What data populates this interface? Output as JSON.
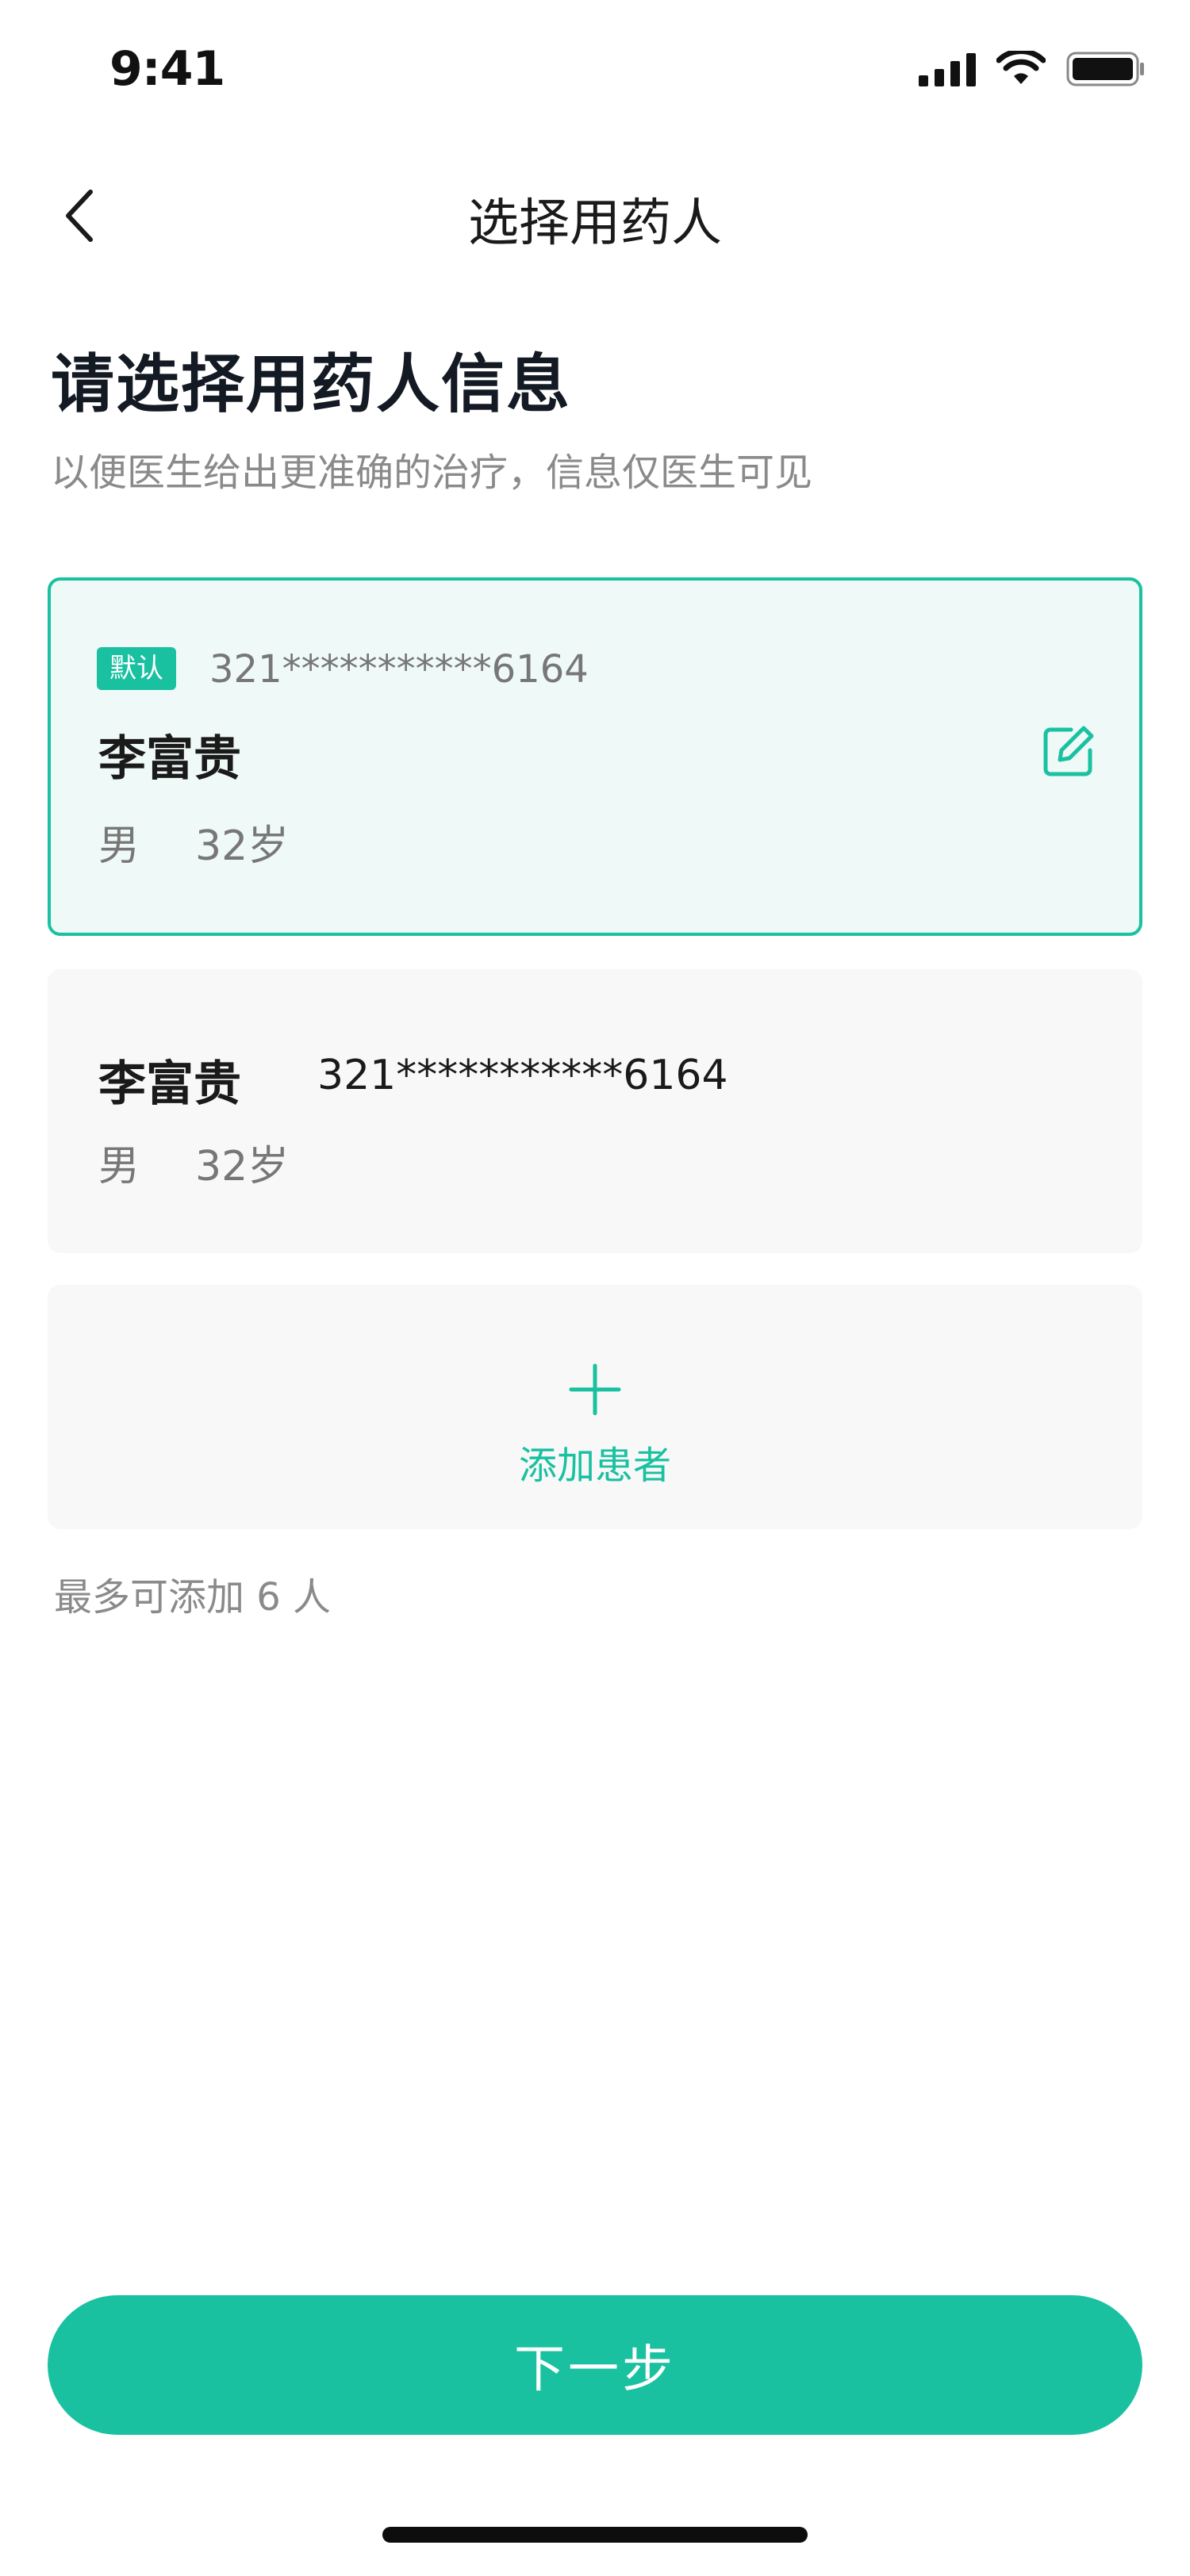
{
  "status_bar": {
    "time": "9:41"
  },
  "nav": {
    "title": "选择用药人"
  },
  "heading": {
    "title": "请选择用药人信息",
    "subtitle": "以便医生给出更准确的治疗，信息仅医生可见"
  },
  "patients": [
    {
      "badge": "默认",
      "id_number": "321***********6164",
      "name": "李富贵",
      "gender": "男",
      "age": "32岁",
      "selected": true
    },
    {
      "id_number": "321***********6164",
      "name": "李富贵",
      "gender": "男",
      "age": "32岁",
      "selected": false
    }
  ],
  "add_patient": {
    "label": "添加患者"
  },
  "limit_note": "最多可添加 6 人",
  "next_button": {
    "label": "下一步"
  },
  "colors": {
    "accent": "#19c1a1",
    "selected_bg": "#eff9f7",
    "card_bg": "#f8f8f8"
  }
}
